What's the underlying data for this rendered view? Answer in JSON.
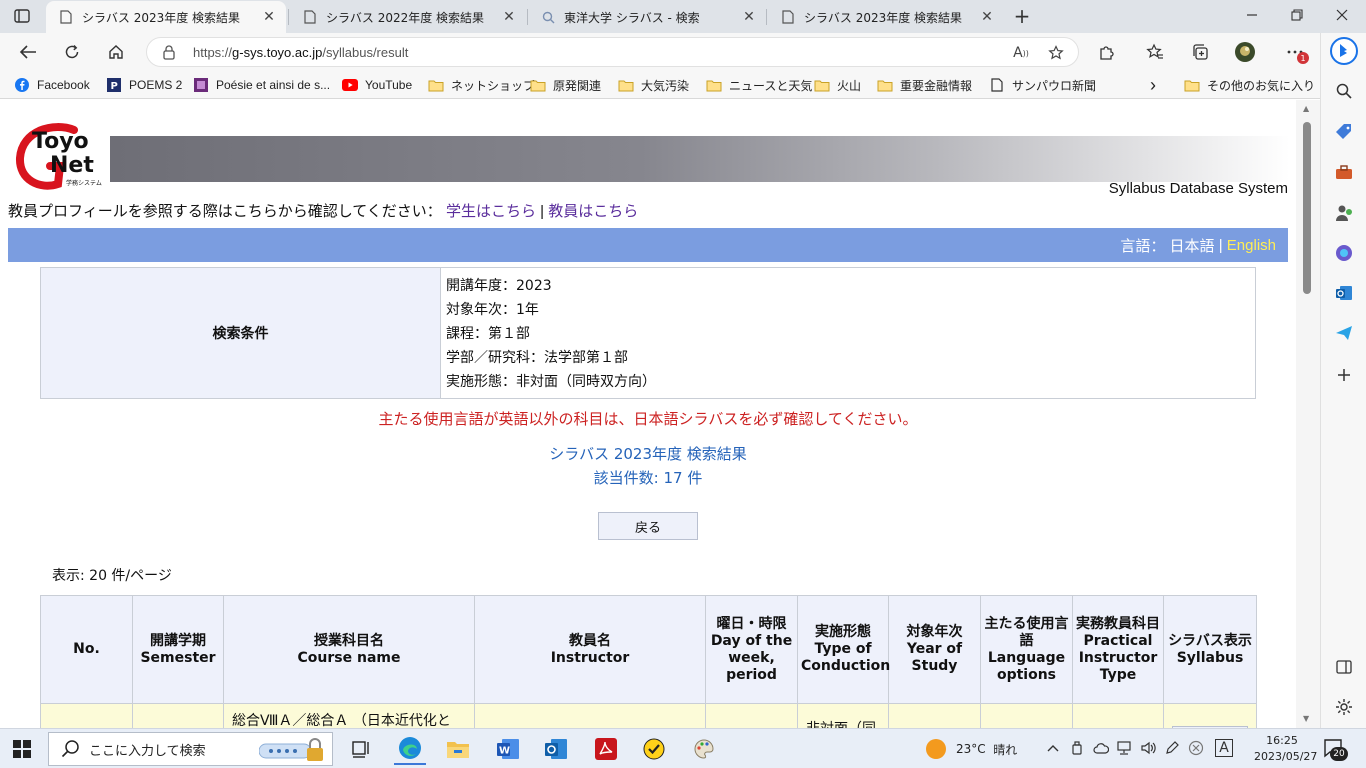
{
  "browser": {
    "tabs": [
      {
        "title": "シラバス 2023年度 検索結果",
        "active": true,
        "icon": "page-icon"
      },
      {
        "title": "シラバス 2022年度 検索結果",
        "active": false,
        "icon": "page-icon"
      },
      {
        "title": "東洋大学 シラバス - 検索",
        "active": false,
        "icon": "search-icon"
      },
      {
        "title": "シラバス 2023年度 検索結果",
        "active": false,
        "icon": "page-icon"
      }
    ],
    "close_glyph": "✕",
    "new_tab_glyph": "+",
    "url_scheme": "https://",
    "url_host": "g-sys.toyo.ac.jp",
    "url_path": "/syllabus/result",
    "read_aloud_glyph": "A",
    "extension_badge": "1"
  },
  "favorites": [
    {
      "label": "Facebook",
      "icon": "facebook-icon"
    },
    {
      "label": "POEMS 2",
      "icon": "poems-icon"
    },
    {
      "label": "Poésie et ainsi de s...",
      "icon": "poesie-icon"
    },
    {
      "label": "YouTube",
      "icon": "youtube-icon"
    },
    {
      "label": "ネットショップ",
      "icon": "folder-icon"
    },
    {
      "label": "原発関連",
      "icon": "folder-icon"
    },
    {
      "label": "大気汚染",
      "icon": "folder-icon"
    },
    {
      "label": "ニュースと天気",
      "icon": "folder-icon"
    },
    {
      "label": "火山",
      "icon": "folder-icon"
    },
    {
      "label": "重要金融情報",
      "icon": "folder-icon"
    },
    {
      "label": "サンパウロ新聞",
      "icon": "page-icon"
    }
  ],
  "favorites_more_glyph": "›",
  "other_favorites": "その他のお気に入り",
  "page": {
    "logo_text_top": "Toyo",
    "logo_text_bottom": "Net",
    "logo_small": "学務システム",
    "system_name": "Syllabus Database System",
    "profile_prompt": "教員プロフィールを参照する際はこちらから確認してください：",
    "student_link": "学生はこちら",
    "separator": "|",
    "teacher_link": "教員はこちら",
    "language_label": "言語：",
    "lang_ja": "日本語",
    "lang_sep": "|",
    "lang_en": "English",
    "criteria_label": "検索条件",
    "criteria": [
      "開講年度：2023",
      "対象年次：1年",
      "課程：第１部",
      "学部／研究科：法学部第１部",
      "実施形態：非対面（同時双方向）"
    ],
    "warning": "主たる使用言語が英語以外の科目は、日本語シラバスを必ず確認してください。",
    "result_title": "シラバス 2023年度 検索結果",
    "result_count": "該当件数: 17 件",
    "back_button": "戻る",
    "per_page": "表示: 20 件/ページ",
    "table": {
      "headers": [
        {
          "ja": "No.",
          "en": ""
        },
        {
          "ja": "開講学期",
          "en": "Semester"
        },
        {
          "ja": "授業科目名",
          "en": "Course name"
        },
        {
          "ja": "教員名",
          "en": "Instructor"
        },
        {
          "ja": "曜日・時限",
          "en": "Day of the week, period"
        },
        {
          "ja": "実施形態",
          "en": "Type of Conduction"
        },
        {
          "ja": "対象年次",
          "en": "Year of Study"
        },
        {
          "ja": "主たる使用言語",
          "en": "Language options"
        },
        {
          "ja": "実務教員科目",
          "en": "Practical Instructor Type"
        },
        {
          "ja": "シラバス表示",
          "en": "Syllabus"
        }
      ],
      "first_row": {
        "course_partial": "総合ⅧＡ／総合Ａ （日本近代化と",
        "conduction_partial": "非対面（同"
      }
    }
  },
  "taskbar": {
    "search_placeholder": "ここに入力して検索",
    "weather_temp": "23°C",
    "weather_desc": "晴れ",
    "ime": "A",
    "time": "16:25",
    "date": "2023/05/27",
    "notifications": "20"
  },
  "colors": {
    "lang_bar": "#7b9de0",
    "header_cell": "#eef1fb",
    "row_cell": "#fcfbd8",
    "warning": "#cc2222",
    "result_link": "#2563b9"
  }
}
